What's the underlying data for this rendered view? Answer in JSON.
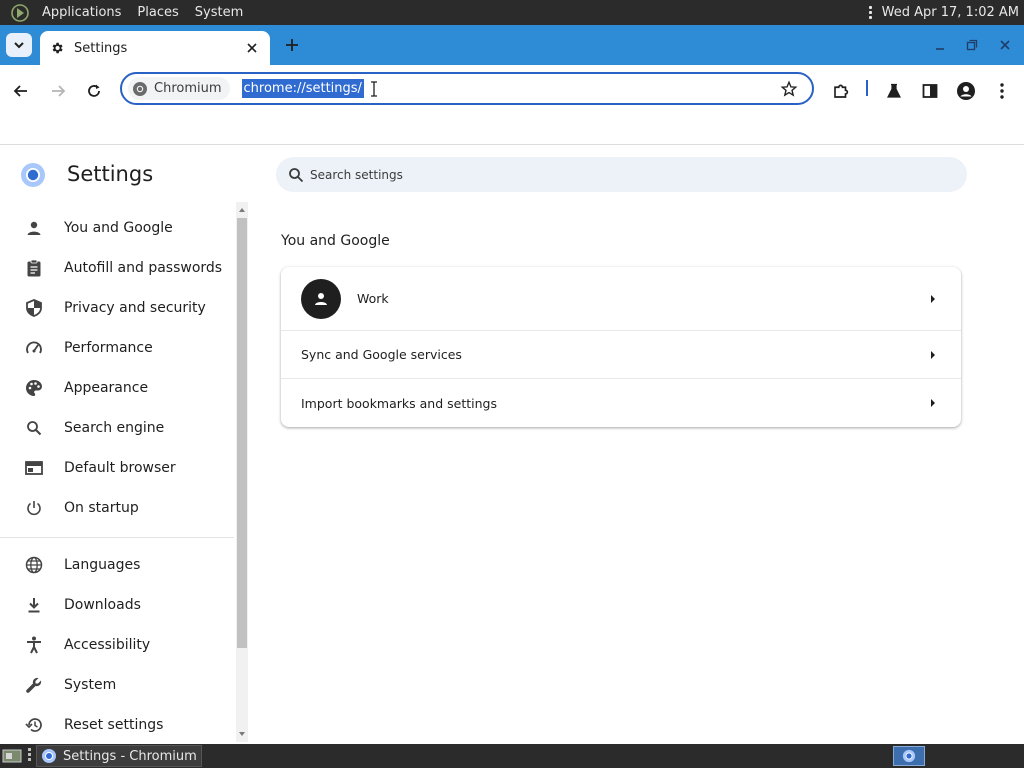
{
  "system_panel": {
    "menus": [
      "Applications",
      "Places",
      "System"
    ],
    "clock": "Wed Apr 17,  1:02 AM"
  },
  "browser": {
    "tab": {
      "title": "Settings"
    },
    "omnibox": {
      "chip_label": "Chromium",
      "url": "chrome://settings/"
    }
  },
  "settings": {
    "heading": "Settings",
    "search_placeholder": "Search settings",
    "nav_items": [
      {
        "label": "You and Google",
        "icon": "person-icon"
      },
      {
        "label": "Autofill and passwords",
        "icon": "clipboard-icon"
      },
      {
        "label": "Privacy and security",
        "icon": "shield-icon"
      },
      {
        "label": "Performance",
        "icon": "speedometer-icon"
      },
      {
        "label": "Appearance",
        "icon": "palette-icon"
      },
      {
        "label": "Search engine",
        "icon": "search-icon"
      },
      {
        "label": "Default browser",
        "icon": "browser-window-icon"
      },
      {
        "label": "On startup",
        "icon": "power-icon"
      },
      {
        "label": "Languages",
        "icon": "globe-icon"
      },
      {
        "label": "Downloads",
        "icon": "download-icon"
      },
      {
        "label": "Accessibility",
        "icon": "accessibility-icon"
      },
      {
        "label": "System",
        "icon": "wrench-icon"
      },
      {
        "label": "Reset settings",
        "icon": "history-icon"
      }
    ],
    "section_title": "You and Google",
    "card_rows": [
      {
        "label": "Work"
      },
      {
        "label": "Sync and Google services"
      },
      {
        "label": "Import bookmarks and settings"
      }
    ]
  },
  "taskbar": {
    "window_title": "Settings - Chromium"
  },
  "colors": {
    "tabstrip": "#2e8bd6",
    "accent": "#2962c4",
    "url_selection": "#2f6bd1",
    "search_bg": "#edf1f8",
    "panel": "#2b2b2b"
  }
}
